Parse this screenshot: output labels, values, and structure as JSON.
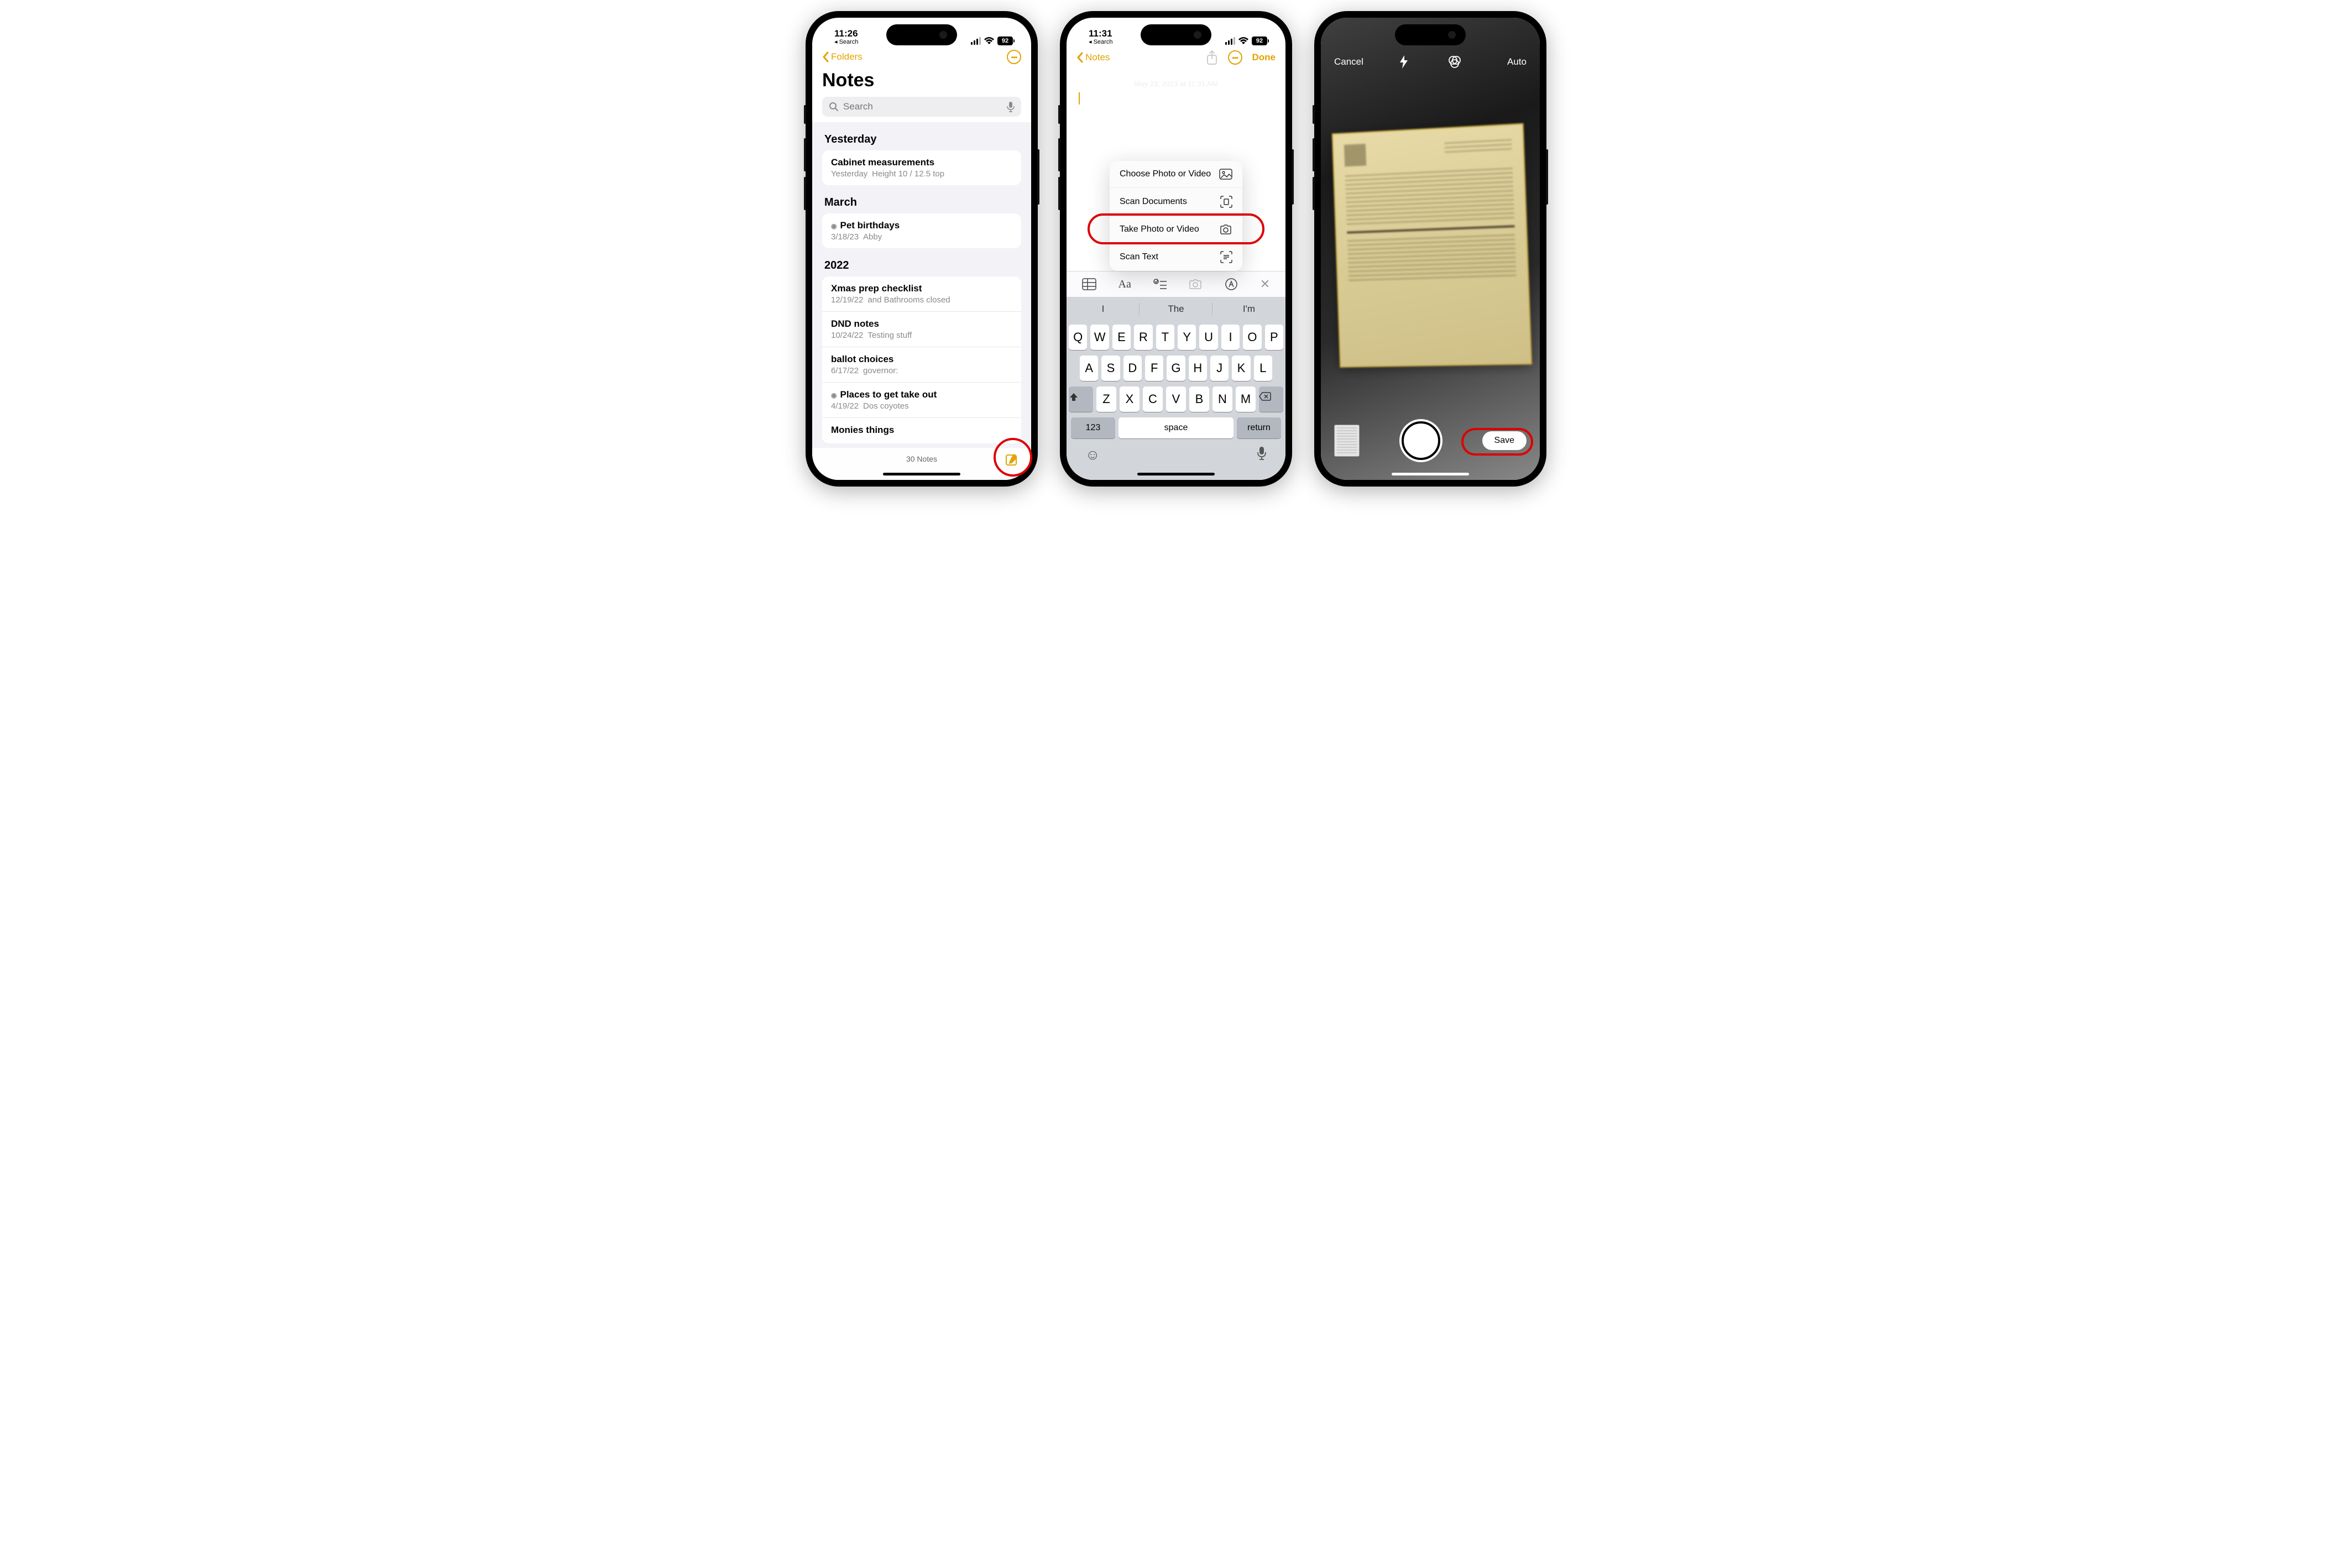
{
  "phone1": {
    "status": {
      "time": "11:26",
      "back": "Search",
      "battery": "92"
    },
    "nav": {
      "back": "Folders"
    },
    "title": "Notes",
    "search": {
      "placeholder": "Search"
    },
    "sections": [
      {
        "header": "Yesterday",
        "items": [
          {
            "title": "Cabinet measurements",
            "date": "Yesterday",
            "preview": "Height 10 / 12.5 top",
            "shared": false
          }
        ]
      },
      {
        "header": "March",
        "items": [
          {
            "title": "Pet birthdays",
            "date": "3/18/23",
            "preview": "Abby",
            "shared": true
          }
        ]
      },
      {
        "header": "2022",
        "items": [
          {
            "title": "Xmas prep checklist",
            "date": "12/19/22",
            "preview": "and Bathrooms closed",
            "shared": false
          },
          {
            "title": "DND notes",
            "date": "10/24/22",
            "preview": "Testing stuff",
            "shared": false
          },
          {
            "title": "ballot choices",
            "date": "6/17/22",
            "preview": "governor:",
            "shared": false
          },
          {
            "title": "Places to get take out",
            "date": "4/19/22",
            "preview": "Dos coyotes",
            "shared": true
          },
          {
            "title": "Monies things",
            "date": "",
            "preview": "",
            "shared": false
          }
        ]
      }
    ],
    "footer": {
      "count": "30 Notes"
    }
  },
  "phone2": {
    "status": {
      "time": "11:31",
      "back": "Search",
      "battery": "92"
    },
    "nav": {
      "back": "Notes",
      "done": "Done"
    },
    "date_placeholder": "May 23, 2023 at 11:31 AM",
    "menu": [
      {
        "label": "Choose Photo or Video",
        "icon": "photo"
      },
      {
        "label": "Scan Documents",
        "icon": "scan-doc"
      },
      {
        "label": "Take Photo or Video",
        "icon": "camera"
      },
      {
        "label": "Scan Text",
        "icon": "scan-text"
      }
    ],
    "suggestions": [
      "I",
      "The",
      "I'm"
    ],
    "keyboard": {
      "r1": [
        "Q",
        "W",
        "E",
        "R",
        "T",
        "Y",
        "U",
        "I",
        "O",
        "P"
      ],
      "r2": [
        "A",
        "S",
        "D",
        "F",
        "G",
        "H",
        "J",
        "K",
        "L"
      ],
      "r3": [
        "Z",
        "X",
        "C",
        "V",
        "B",
        "N",
        "M"
      ],
      "numbers": "123",
      "space": "space",
      "return": "return"
    }
  },
  "phone3": {
    "top": {
      "cancel": "Cancel",
      "auto": "Auto"
    },
    "bottom": {
      "save": "Save"
    }
  }
}
